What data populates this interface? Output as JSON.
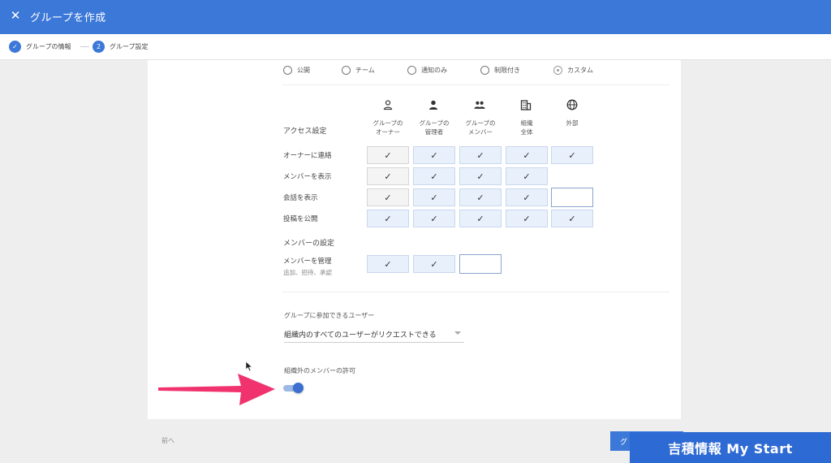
{
  "header": {
    "title": "グループを作成",
    "close_icon": "close-icon"
  },
  "stepper": {
    "steps": [
      {
        "label": "グループの情報",
        "state": "done",
        "icon": "check-icon"
      },
      {
        "label": "グループ設定",
        "number": "2",
        "state": "active"
      }
    ]
  },
  "access_type": {
    "options": [
      "公開",
      "チーム",
      "通知のみ",
      "制限付き",
      "カスタム"
    ],
    "selected": "カスタム"
  },
  "permissions": {
    "section_title": "アクセス設定",
    "columns": [
      {
        "label": "グループの\nオーナー",
        "icon": "person-outline-icon"
      },
      {
        "label": "グループの\n管理者",
        "icon": "person-icon"
      },
      {
        "label": "グループの\nメンバー",
        "icon": "people-icon"
      },
      {
        "label": "組織\n全体",
        "icon": "building-icon"
      },
      {
        "label": "外部",
        "icon": "globe-icon"
      }
    ],
    "rows": [
      {
        "label": "オーナーに連絡",
        "cells": [
          "gray-check",
          "check",
          "check",
          "check",
          "check"
        ]
      },
      {
        "label": "メンバーを表示",
        "cells": [
          "gray-check",
          "check",
          "check",
          "check",
          "none"
        ]
      },
      {
        "label": "会話を表示",
        "cells": [
          "gray-check",
          "check",
          "check",
          "check",
          "empty"
        ]
      },
      {
        "label": "投稿を公開",
        "cells": [
          "check",
          "check",
          "check",
          "check",
          "check"
        ]
      }
    ],
    "check_mark": "✓"
  },
  "member_settings": {
    "section_title": "メンバーの設定",
    "row_label": "メンバーを管理",
    "row_sublabel": "追加、招待、承認",
    "cells": [
      "check",
      "check",
      "empty"
    ]
  },
  "join": {
    "label": "グループに参加できるユーザー",
    "value": "組織内のすべてのユーザーがリクエストできる"
  },
  "external": {
    "label": "組織外のメンバーの許可",
    "enabled": true
  },
  "footer": {
    "prev_label": "前へ",
    "next_label": "グ"
  },
  "watermark": "吉積情報 My Start",
  "colors": {
    "primary": "#3c78d8",
    "cell_bg": "#e8f0fb",
    "arrow": "#f0336e"
  }
}
